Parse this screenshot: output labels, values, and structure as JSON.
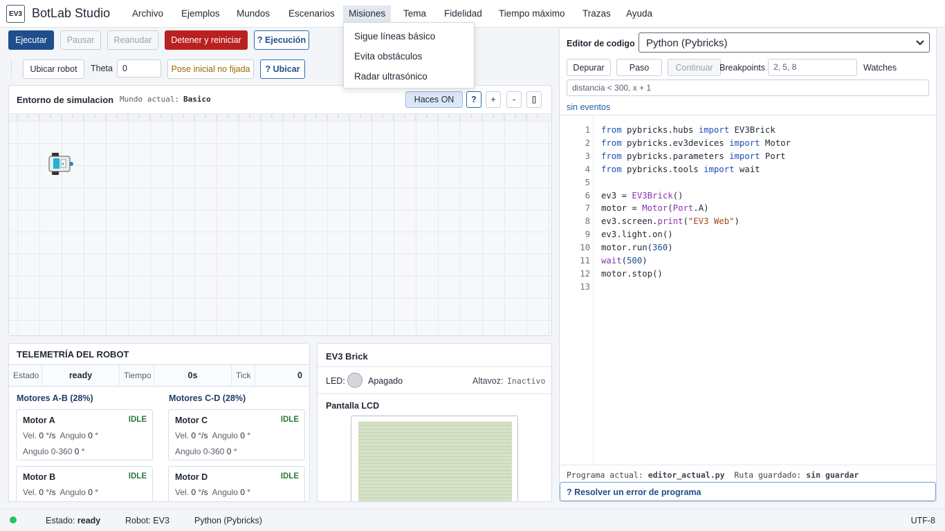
{
  "app": {
    "logo": "EV3",
    "title": "BotLab Studio"
  },
  "menu": [
    "Archivo",
    "Ejemplos",
    "Mundos",
    "Escenarios",
    "Misiones",
    "Tema",
    "Fidelidad",
    "Tiempo máximo",
    "Trazas",
    "Ayuda"
  ],
  "missions_menu": [
    "Sigue líneas básico",
    "Evita obstáculos",
    "Radar ultrasónico"
  ],
  "toolbar": {
    "run": "Ejecutar",
    "pause": "Pausar",
    "resume": "Reanudar",
    "stop": "Detener y reiniciar",
    "exec_help": "? Ejecución",
    "locate": "Ubicar robot",
    "theta_label": "Theta",
    "theta_value": "0",
    "pose_status": "Pose inicial no fijada",
    "locate_help": "? Ubicar"
  },
  "sim": {
    "title": "Entorno de simulacion",
    "world_label": "Mundo actual:",
    "world_value": "Basico",
    "haces": "Haces ON",
    "help": "?",
    "zoom_in": "+",
    "zoom_out": "-",
    "fit": "[]"
  },
  "telemetry": {
    "title": "TELEMETRÍA DEL ROBOT",
    "estado_label": "Estado",
    "estado_value": "ready",
    "tiempo_label": "Tiempo",
    "tiempo_value": "0s",
    "tick_label": "Tick",
    "tick_value": "0",
    "group_ab": "Motores A-B (28%)",
    "group_cd": "Motores C-D (28%)",
    "motors": [
      {
        "name": "Motor A",
        "status": "IDLE",
        "vel_label": "Vel.",
        "vel": "0 °/s",
        "ang_label": "Angulo",
        "ang": "0 °",
        "ang360_label": "Angulo 0-360",
        "ang360": "0 °"
      },
      {
        "name": "Motor C",
        "status": "IDLE",
        "vel_label": "Vel.",
        "vel": "0 °/s",
        "ang_label": "Angulo",
        "ang": "0 °",
        "ang360_label": "Angulo 0-360",
        "ang360": "0 °"
      },
      {
        "name": "Motor B",
        "status": "IDLE",
        "vel_label": "Vel.",
        "vel": "0 °/s",
        "ang_label": "Angulo",
        "ang": "0 °"
      },
      {
        "name": "Motor D",
        "status": "IDLE",
        "vel_label": "Vel.",
        "vel": "0 °/s",
        "ang_label": "Angulo",
        "ang": "0 °"
      }
    ]
  },
  "brick": {
    "title": "EV3 Brick",
    "led_label": "LED:",
    "led_value": "Apagado",
    "speaker_label": "Altavoz:",
    "speaker_value": "Inactivo",
    "lcd_title": "Pantalla LCD"
  },
  "editor": {
    "title": "Editor de codigo",
    "language": "Python (Pybricks)",
    "debug": "Depurar",
    "step": "Paso",
    "continue": "Continuar",
    "breakpoints_label": "Breakpoints",
    "breakpoints_value": "2, 5, 8",
    "watches_label": "Watches",
    "watches_value": "distancia < 300, x + 1",
    "events": "sin eventos",
    "program_label": "Programa actual:",
    "program_value": "editor_actual.py",
    "path_label": "Ruta guardado:",
    "path_value": "sin guardar",
    "resolve": "? Resolver un error de programa"
  },
  "code_lines": [
    [
      [
        "kw",
        "from"
      ],
      [
        "t",
        " pybricks.hubs "
      ],
      [
        "kw",
        "import"
      ],
      [
        "t",
        " EV3Brick"
      ]
    ],
    [
      [
        "kw",
        "from"
      ],
      [
        "t",
        " pybricks.ev3devices "
      ],
      [
        "kw",
        "import"
      ],
      [
        "t",
        " Motor"
      ]
    ],
    [
      [
        "kw",
        "from"
      ],
      [
        "t",
        " pybricks.parameters "
      ],
      [
        "kw",
        "import"
      ],
      [
        "t",
        " Port"
      ]
    ],
    [
      [
        "kw",
        "from"
      ],
      [
        "t",
        " pybricks.tools "
      ],
      [
        "kw",
        "import"
      ],
      [
        "t",
        " wait"
      ]
    ],
    [],
    [
      [
        "t",
        "ev3 = "
      ],
      [
        "fn",
        "EV3Brick"
      ],
      [
        "t",
        "()"
      ]
    ],
    [
      [
        "t",
        "motor = "
      ],
      [
        "fn",
        "Motor"
      ],
      [
        "t",
        "("
      ],
      [
        "fn",
        "Port"
      ],
      [
        "t",
        ".A)"
      ]
    ],
    [
      [
        "t",
        "ev3.screen."
      ],
      [
        "fn",
        "print"
      ],
      [
        "t",
        "("
      ],
      [
        "str",
        "\"EV3 Web\""
      ],
      [
        "t",
        ")"
      ]
    ],
    [
      [
        "t",
        "ev3.light.on()"
      ]
    ],
    [
      [
        "t",
        "motor.run("
      ],
      [
        "num",
        "360"
      ],
      [
        "t",
        ")"
      ]
    ],
    [
      [
        "fn",
        "wait"
      ],
      [
        "t",
        "("
      ],
      [
        "num",
        "500"
      ],
      [
        "t",
        ")"
      ]
    ],
    [
      [
        "t",
        "motor.stop()"
      ]
    ],
    []
  ],
  "statusbar": {
    "estado_label": "Estado:",
    "estado_value": "ready",
    "robot": "Robot: EV3",
    "language": "Python (Pybricks)",
    "encoding": "UTF-8"
  },
  "colors": {
    "primary": "#1f4e8c",
    "danger": "#b9201f",
    "ok": "#2a7a3b",
    "status_dot": "#22c55e"
  },
  "icons": {
    "status": "status-dot-icon",
    "robot": "robot-icon",
    "led": "led-indicator-icon"
  }
}
